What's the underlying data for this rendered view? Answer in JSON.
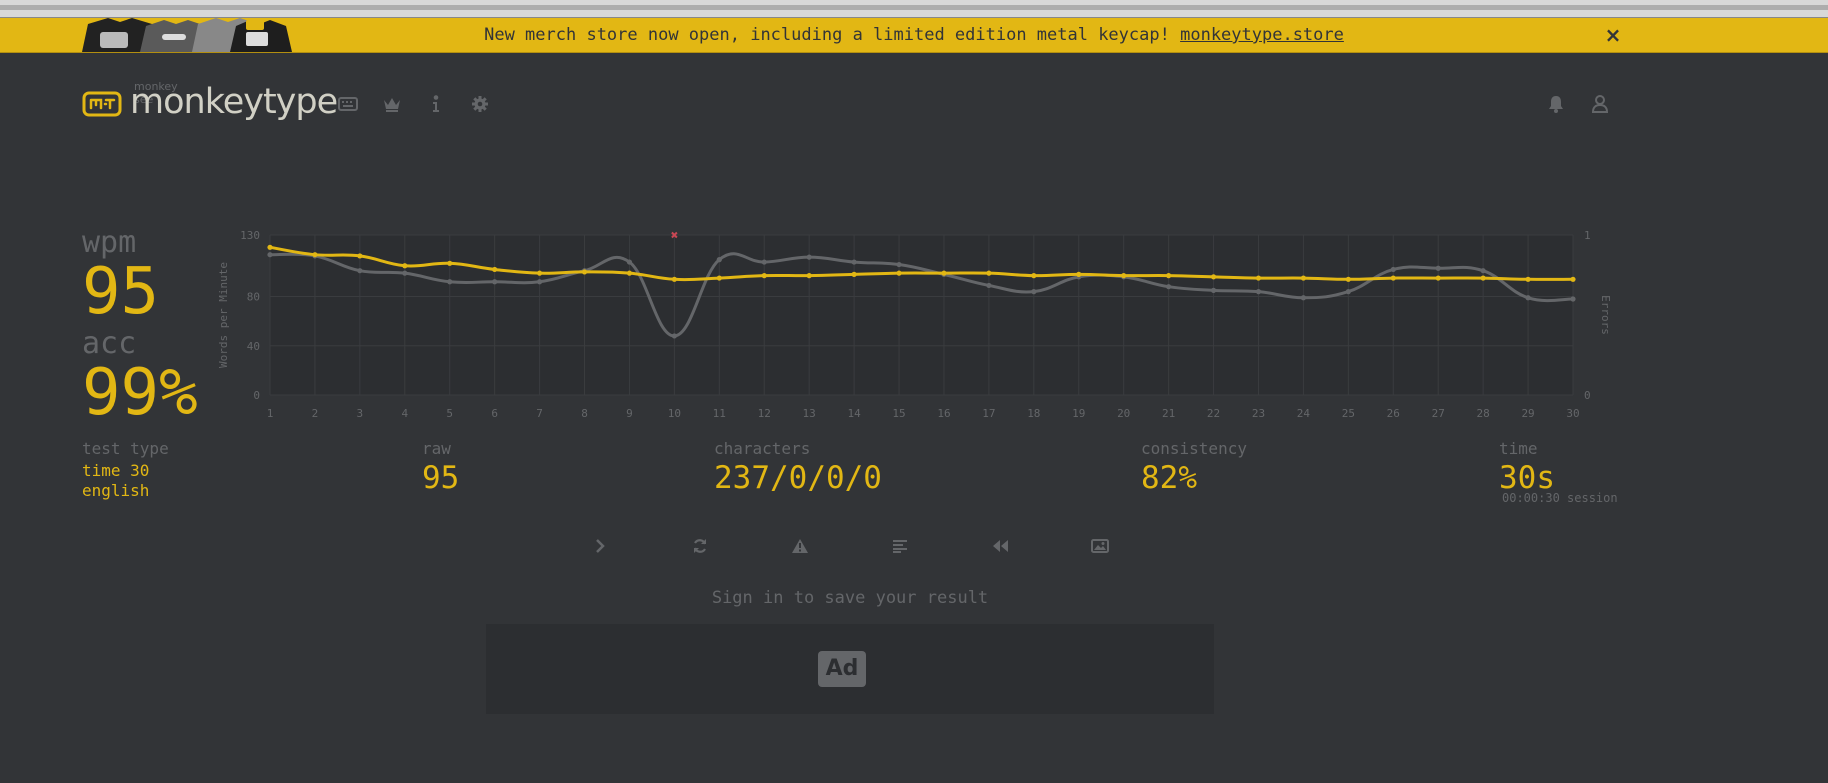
{
  "banner": {
    "message": "New merch store now open, including a limited edition metal keycap!",
    "link_text": "monkeytype.store",
    "close_label": "×"
  },
  "header": {
    "logo_subtext": "monkey see",
    "logo_text": "monkeytype",
    "nav_icons": [
      "keyboard-icon",
      "crown-icon",
      "info-icon",
      "gear-icon"
    ],
    "right_icons": [
      "bell-icon",
      "user-icon"
    ]
  },
  "result": {
    "wpm_label": "wpm",
    "wpm_value": "95",
    "acc_label": "acc",
    "acc_value": "99%",
    "test_type_label": "test type",
    "test_type_mode": "time 30",
    "test_type_language": "english",
    "raw_label": "raw",
    "raw_value": "95",
    "characters_label": "characters",
    "characters_value": "237/0/0/0",
    "consistency_label": "consistency",
    "consistency_value": "82%",
    "time_label": "time",
    "time_value": "30s",
    "session_text": "00:00:30 session"
  },
  "actions": {
    "icons": [
      "next-test-icon",
      "restart-icon",
      "warning-icon",
      "word-history-icon",
      "replay-icon",
      "screenshot-icon"
    ],
    "signin_text": "Sign in to save your result",
    "ad_label": "Ad"
  },
  "colors": {
    "background": "#323437",
    "accent": "#e2b714",
    "subtext": "#646669",
    "text": "#d1d0c5",
    "error": "#ca4754"
  },
  "chart_data": {
    "type": "line",
    "x": [
      1,
      2,
      3,
      4,
      5,
      6,
      7,
      8,
      9,
      10,
      11,
      12,
      13,
      14,
      15,
      16,
      17,
      18,
      19,
      20,
      21,
      22,
      23,
      24,
      25,
      26,
      27,
      28,
      29,
      30
    ],
    "ylabel": "Words per Minute",
    "y2label": "Errors",
    "ylim": [
      0,
      130
    ],
    "y2lim": [
      0,
      1
    ],
    "y_ticks": [
      0,
      40,
      80,
      130
    ],
    "y2_ticks": [
      0,
      1
    ],
    "grid": true,
    "series": [
      {
        "role": "wpm",
        "color": "#e2b714",
        "values": [
          120,
          114,
          113,
          105,
          107,
          102,
          99,
          100,
          99,
          94,
          95,
          97,
          97,
          98,
          99,
          99,
          99,
          97,
          98,
          97,
          97,
          96,
          95,
          95,
          94,
          95,
          95,
          95,
          94,
          94
        ]
      },
      {
        "role": "raw",
        "color": "#646669",
        "values": [
          114,
          113,
          101,
          99,
          92,
          92,
          92,
          101,
          108,
          48,
          110,
          108,
          112,
          108,
          106,
          98,
          89,
          84,
          96,
          96,
          88,
          85,
          84,
          79,
          84,
          102,
          103,
          101,
          79,
          78
        ]
      },
      {
        "role": "errors",
        "color": "#ca4754",
        "points": [
          {
            "x": 10,
            "y": 1
          }
        ]
      }
    ]
  }
}
